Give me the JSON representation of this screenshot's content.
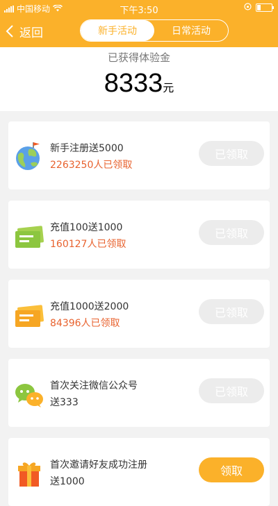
{
  "status_bar": {
    "carrier": "中国移动",
    "time": "下午3:50"
  },
  "nav": {
    "back_label": "返回",
    "tabs": [
      {
        "label": "新手活动",
        "active": true
      },
      {
        "label": "日常活动",
        "active": false
      }
    ]
  },
  "summary": {
    "label": "已获得体验金",
    "amount": "8333",
    "unit": "元"
  },
  "activities": [
    {
      "icon": "globe-flag-icon",
      "title": "新手注册送5000",
      "count": "2263250人已领取",
      "button": "已领取",
      "claimed": true
    },
    {
      "icon": "green-card-icon",
      "title": "充值100送1000",
      "count": "160127人已领取",
      "button": "已领取",
      "claimed": true
    },
    {
      "icon": "yellow-card-icon",
      "title": "充值1000送2000",
      "count": "84396人已领取",
      "button": "已领取",
      "claimed": true
    },
    {
      "icon": "wechat-icon",
      "title": "首次关注微信公众号",
      "subtitle": "送333",
      "button": "已领取",
      "claimed": true
    },
    {
      "icon": "gift-icon",
      "title": "首次邀请好友成功注册",
      "subtitle": "送1000",
      "button": "领取",
      "claimed": false
    }
  ],
  "colors": {
    "accent": "#fbb12a",
    "count_text": "#e8622e",
    "claimed_button": "#ececec"
  }
}
